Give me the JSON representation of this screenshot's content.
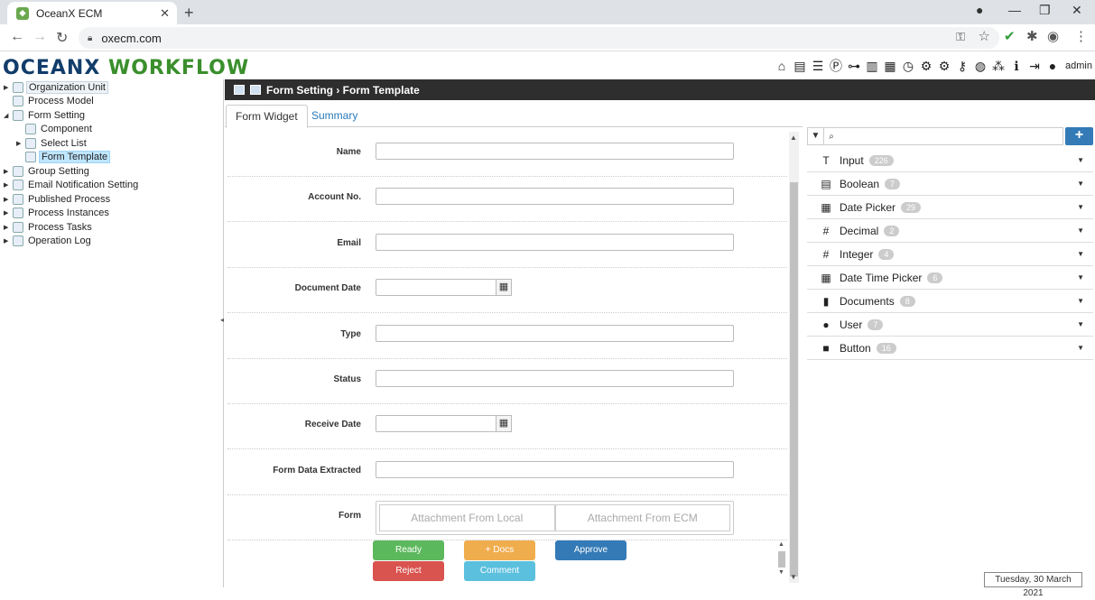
{
  "browser": {
    "tab_title": "OceanX ECM",
    "url": "oxecm.com"
  },
  "app": {
    "logo_part1": "OCEANX",
    "logo_part2": "WORKFLOW",
    "user": "admin"
  },
  "tree": [
    {
      "label": "Organization Unit"
    },
    {
      "label": "Process Model"
    },
    {
      "label": "Form Setting"
    },
    {
      "label": "Component"
    },
    {
      "label": "Select List"
    },
    {
      "label": "Form Template"
    },
    {
      "label": "Group Setting"
    },
    {
      "label": "Email Notification Setting"
    },
    {
      "label": "Published Process"
    },
    {
      "label": "Process Instances"
    },
    {
      "label": "Process Tasks"
    },
    {
      "label": "Operation Log"
    }
  ],
  "header": {
    "breadcrumb": "Form Setting › Form Template"
  },
  "tabs": {
    "widget": "Form Widget",
    "summary": "Summary"
  },
  "fields": [
    {
      "label": "Name"
    },
    {
      "label": "Account No."
    },
    {
      "label": "Email"
    },
    {
      "label": "Document Date"
    },
    {
      "label": "Type"
    },
    {
      "label": "Status"
    },
    {
      "label": "Receive Date"
    },
    {
      "label": "Form Data Extracted"
    },
    {
      "label": "Form"
    }
  ],
  "attach": {
    "local": "Attachment From Local",
    "ecm": "Attachment From ECM"
  },
  "buttons": {
    "ready": "Ready",
    "docs": "+ Docs",
    "approve": "Approve",
    "reject": "Reject",
    "comment": "Comment"
  },
  "widgets": [
    {
      "name": "Input",
      "count": "226"
    },
    {
      "name": "Boolean",
      "count": "7"
    },
    {
      "name": "Date Picker",
      "count": "29"
    },
    {
      "name": "Decimal",
      "count": "2"
    },
    {
      "name": "Integer",
      "count": "4"
    },
    {
      "name": "Date Time Picker",
      "count": "6"
    },
    {
      "name": "Documents",
      "count": "8"
    },
    {
      "name": "User",
      "count": "7"
    },
    {
      "name": "Button",
      "count": "16"
    }
  ],
  "status": {
    "date": "Tuesday, 30 March 2021"
  },
  "colors": {
    "ready": "#5cb85c",
    "docs": "#f0ad4e",
    "approve": "#337ab7",
    "reject": "#d9534f",
    "comment": "#5bc0de",
    "header": "#2e2e2e"
  }
}
